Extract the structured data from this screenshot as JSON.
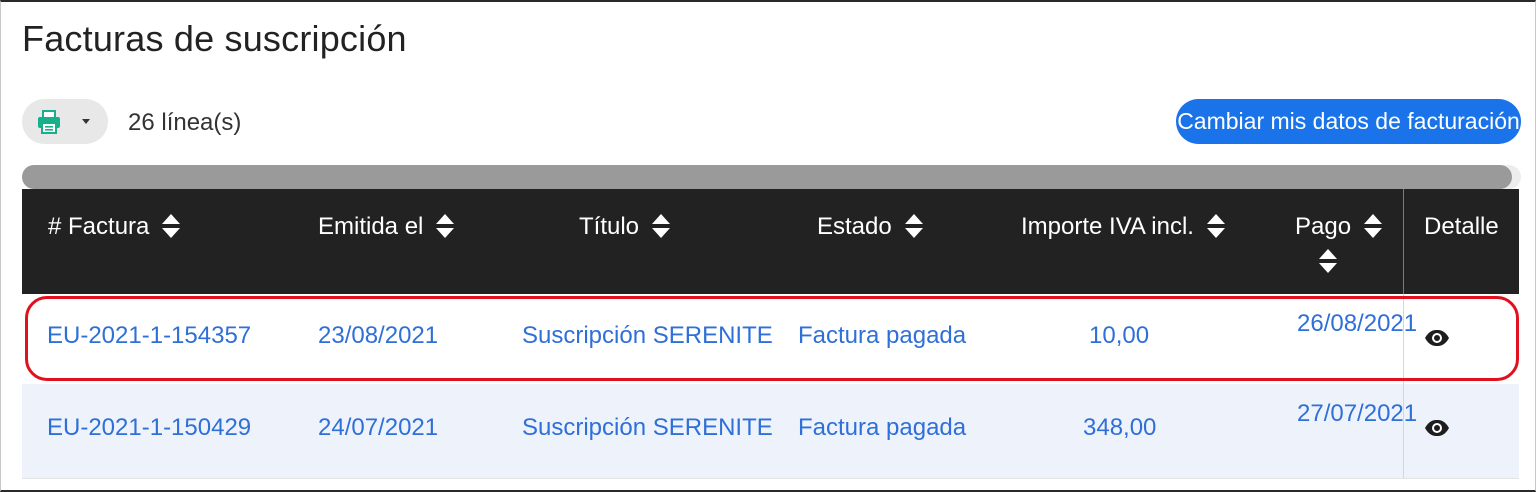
{
  "page": {
    "title": "Facturas de suscripción"
  },
  "toolbar": {
    "export_icon": "printer-icon",
    "line_count": "26 línea(s)",
    "change_billing_label": "Cambiar mis datos de facturación"
  },
  "table": {
    "columns": [
      "# Factura",
      "Emitida el",
      "Título",
      "Estado",
      "Importe IVA incl.",
      "Pago",
      "Detalle"
    ],
    "rows": [
      {
        "invoice": "EU-2021-1-154357",
        "issued": "23/08/2021",
        "title": "Suscripción SERENITE",
        "status": "Factura pagada",
        "amount": "10,00",
        "payment_date": "26/08/2021",
        "detail_icon": "eye-icon",
        "highlighted": true
      },
      {
        "invoice": "EU-2021-1-150429",
        "issued": "24/07/2021",
        "title": "Suscripción SERENITE",
        "status": "Factura pagada",
        "amount": "348,00",
        "payment_date": "27/07/2021",
        "detail_icon": "eye-icon",
        "highlighted": false
      }
    ]
  },
  "colors": {
    "accent": "#1a73e8",
    "link": "#2f6fd8",
    "header_bg": "#222222",
    "highlight": "#e0101e",
    "alt_row": "#eef3fb"
  }
}
